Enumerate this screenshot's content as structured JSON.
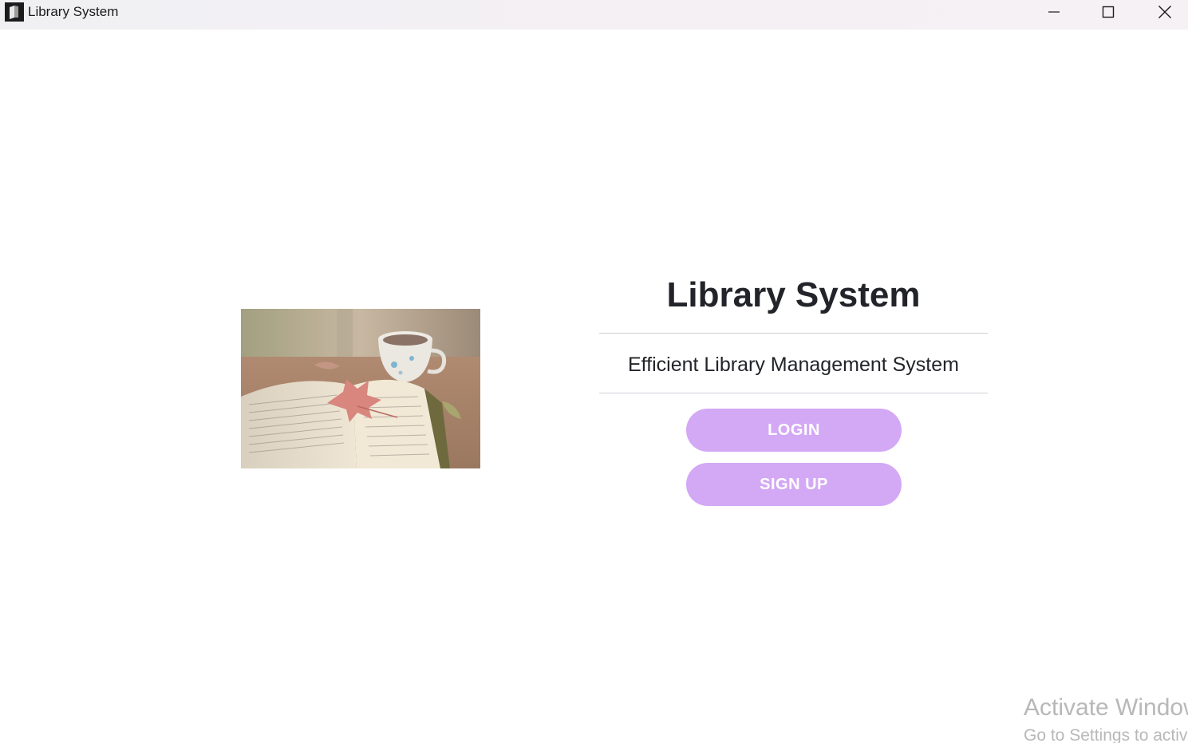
{
  "window": {
    "title": "Library System",
    "app_icon": "book-icon",
    "controls": {
      "minimize_icon": "minimize-icon",
      "maximize_icon": "maximize-icon",
      "close_icon": "close-icon"
    }
  },
  "main": {
    "image": "book-coffee-photo",
    "title": "Library System",
    "tagline": "Efficient Library Management System",
    "login_label": "LOGIN",
    "signup_label": "SIGN UP",
    "button_color": "#d3a8f5"
  },
  "watermark": {
    "title": "Activate Windows",
    "subtitle": "Go to Settings to activate Windows."
  }
}
